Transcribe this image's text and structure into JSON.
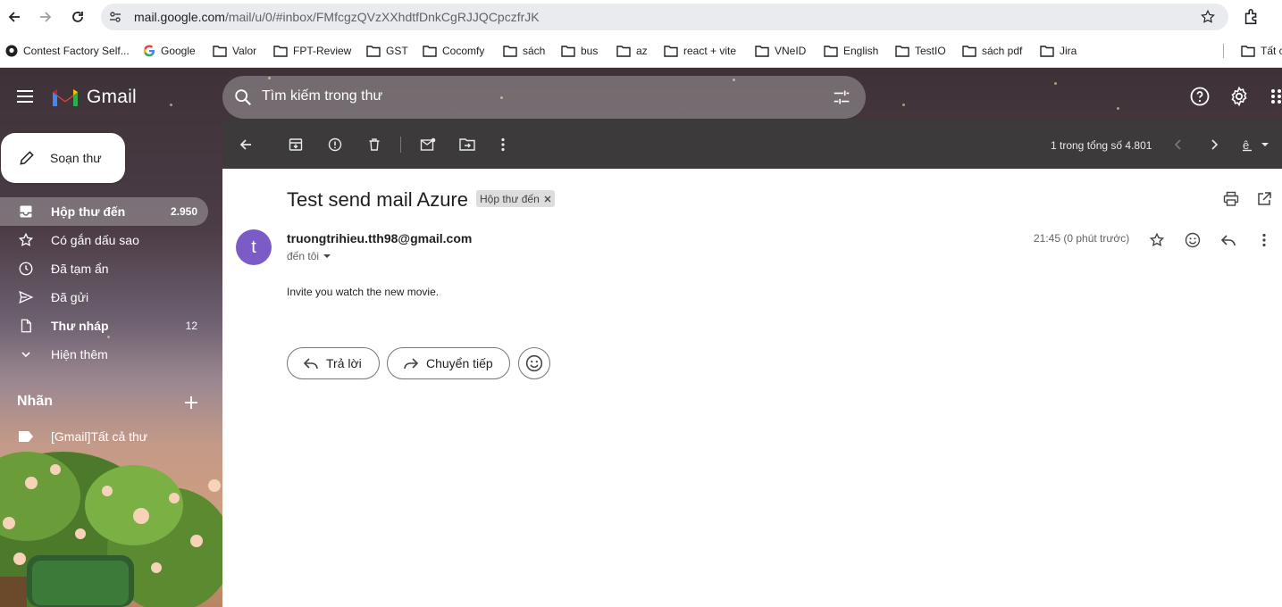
{
  "browser": {
    "url_host": "mail.google.com",
    "url_path": "/mail/u/0/#inbox/FMfcgzQVzXXhdtfDnkCgRJJQCpczfrJK",
    "bookmarks": [
      "Contest Factory Self...",
      "Google",
      "Valor",
      "FPT-Review",
      "GST",
      "Cocomfy",
      "sách",
      "bus",
      "az",
      "react + vite",
      "VNeID",
      "English",
      "TestIO",
      "sách pdf",
      "Jira",
      "Tất c"
    ]
  },
  "gmail": {
    "logo_text": "Gmail",
    "search_placeholder": "Tìm kiếm trong thư",
    "compose_label": "Soạn thư",
    "nav": [
      {
        "label": "Hộp thư đến",
        "count": "2.950",
        "icon": "inbox-icon",
        "active": true
      },
      {
        "label": "Có gắn dấu sao",
        "count": "",
        "icon": "star-icon",
        "active": false
      },
      {
        "label": "Đã tạm ẩn",
        "count": "",
        "icon": "clock-icon",
        "active": false
      },
      {
        "label": "Đã gửi",
        "count": "",
        "icon": "send-icon",
        "active": false
      },
      {
        "label": "Thư nháp",
        "count": "12",
        "icon": "draft-icon",
        "active": false
      },
      {
        "label": "Hiện thêm",
        "count": "",
        "icon": "chevron-down-icon",
        "active": false
      }
    ],
    "labels_heading": "Nhãn",
    "labels": [
      {
        "label": "[Gmail]Tất cả thư",
        "icon": "label-icon"
      }
    ],
    "pager_text": "1 trong tổng số 4.801"
  },
  "message": {
    "subject": "Test send mail Azure",
    "label_chip": "Hộp thư đến",
    "avatar_letter": "t",
    "sender": "truongtrihieu.tth98@gmail.com",
    "to": "đến tôi",
    "time": "21:45 (0 phút trước)",
    "body": "Invite you watch the new movie.",
    "reply_label": "Trả lời",
    "forward_label": "Chuyển tiếp"
  },
  "colors": {
    "avatar": "#7b5cc7",
    "toolbar": "#3d3a3c"
  }
}
